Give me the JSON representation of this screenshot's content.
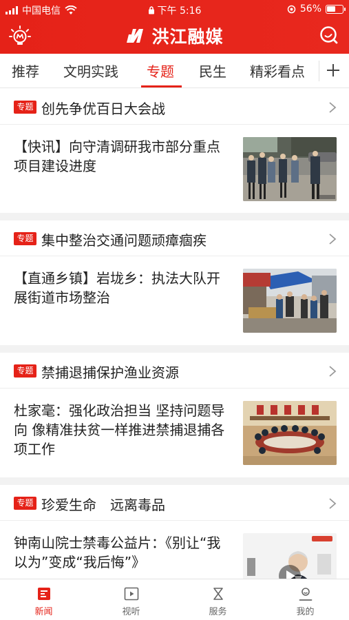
{
  "status_bar": {
    "carrier": "中国电信",
    "time": "下午 5:16",
    "battery": "56%"
  },
  "app": {
    "title": "洪江融媒"
  },
  "tabs": [
    {
      "label": "推荐"
    },
    {
      "label": "文明实践"
    },
    {
      "label": "专题"
    },
    {
      "label": "民生"
    },
    {
      "label": "精彩看点"
    }
  ],
  "active_tab": "专题",
  "badge_label": "专题",
  "sections": [
    {
      "title": "创先争优百日大会战",
      "article": {
        "title": "【快讯】向守清调研我市部分重点项目建设进度"
      }
    },
    {
      "title": "集中整治交通问题顽瘴痼疾",
      "article": {
        "title": "【直通乡镇】岩垅乡：执法大队开展街道市场整治"
      }
    },
    {
      "title": "禁捕退捕保护渔业资源",
      "article": {
        "title": "杜家毫：强化政治担当 坚持问题导向 像精准扶贫一样推进禁捕退捕各项工作"
      }
    },
    {
      "title": "珍爱生命　远离毒品",
      "article": {
        "title": "钟南山院士禁毒公益片：《别让“我以为”变成“我后悔”》"
      }
    }
  ],
  "bottom_nav": [
    {
      "label": "新闻",
      "icon": "news-icon"
    },
    {
      "label": "视听",
      "icon": "video-icon"
    },
    {
      "label": "服务",
      "icon": "service-icon"
    },
    {
      "label": "我的",
      "icon": "profile-icon"
    }
  ],
  "colors": {
    "brand": "#e52218",
    "background": "#ffffff",
    "separator": "#f2f2f2"
  }
}
